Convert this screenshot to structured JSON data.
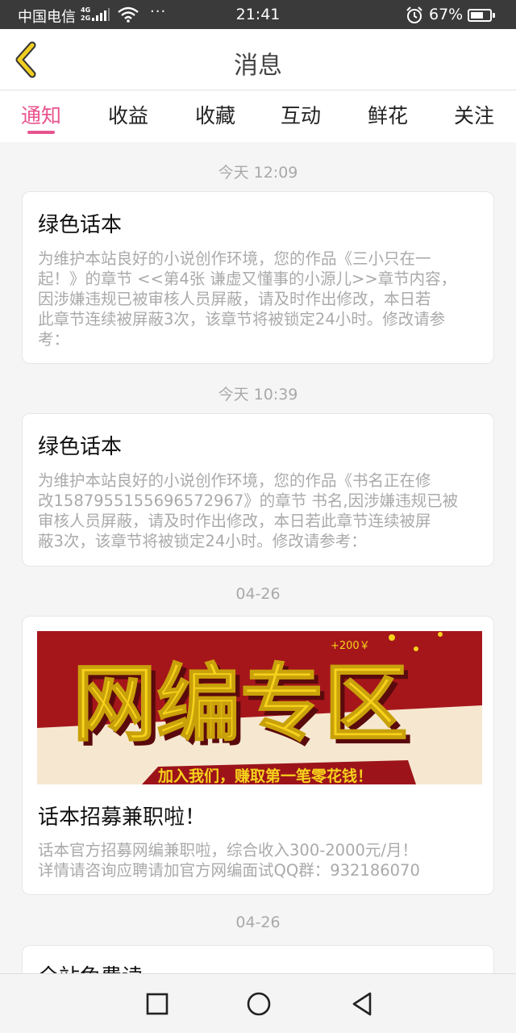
{
  "status_bar": {
    "carrier": "中国电信",
    "net_top": "4G",
    "net_bottom": "2G",
    "more": "···",
    "time": "21:41",
    "battery_percent": "67%",
    "battery_level": 0.67,
    "icons": [
      "signal-icon",
      "wifi-icon",
      "alarm-icon",
      "battery-icon"
    ]
  },
  "header": {
    "title": "消息",
    "back_icon": "chevron-left-icon"
  },
  "tabs": [
    {
      "label": "通知",
      "active": true
    },
    {
      "label": "收益",
      "active": false
    },
    {
      "label": "收藏",
      "active": false
    },
    {
      "label": "互动",
      "active": false
    },
    {
      "label": "鲜花",
      "active": false
    },
    {
      "label": "关注",
      "active": false
    }
  ],
  "messages": [
    {
      "date": "今天 12:09",
      "title": "绿色话本",
      "body_lines": [
        "为维护本站良好的小说创作环境，您的作品《三小只在一",
        "起！》的章节 <<第4张  谦虚又懂事的小源儿>>章节内容，",
        "因涉嫌违规已被审核人员屏蔽，请及时作出修改，本日若",
        "此章节连续被屏蔽3次，该章节将被锁定24小时。修改请参",
        "考："
      ]
    },
    {
      "date": "今天 10:39",
      "title": "绿色话本",
      "body_lines": [
        "为维护本站良好的小说创作环境，您的作品《书名正在修",
        "改1587955155696572967》的章节 书名,因涉嫌违规已被",
        "审核人员屏蔽，请及时作出修改，本日若此章节连续被屏",
        "蔽3次，该章节将被锁定24小时。修改请参考："
      ]
    },
    {
      "date": "04-26",
      "banner": {
        "headline": "网编专区",
        "reward": "+200￥",
        "slogan": "加入我们，赚取第一笔零花钱！",
        "colors": {
          "red": "#a5161b",
          "yellow": "#f7d21b",
          "cream": "#f6e8d0"
        }
      },
      "title": "话本招募兼职啦！",
      "body_lines": [
        "话本官方招募网编兼职啦，综合收入300-2000元/月！",
        "详情请咨询应聘请加官方网编面试QQ群：932186070"
      ]
    },
    {
      "date": "04-26",
      "title": "全站免费读"
    }
  ],
  "nav": {
    "icons": [
      "square-icon",
      "circle-icon",
      "back-triangle-icon"
    ]
  },
  "colors": {
    "accent": "#e8548e",
    "back_arrow": "#f0cf22"
  }
}
